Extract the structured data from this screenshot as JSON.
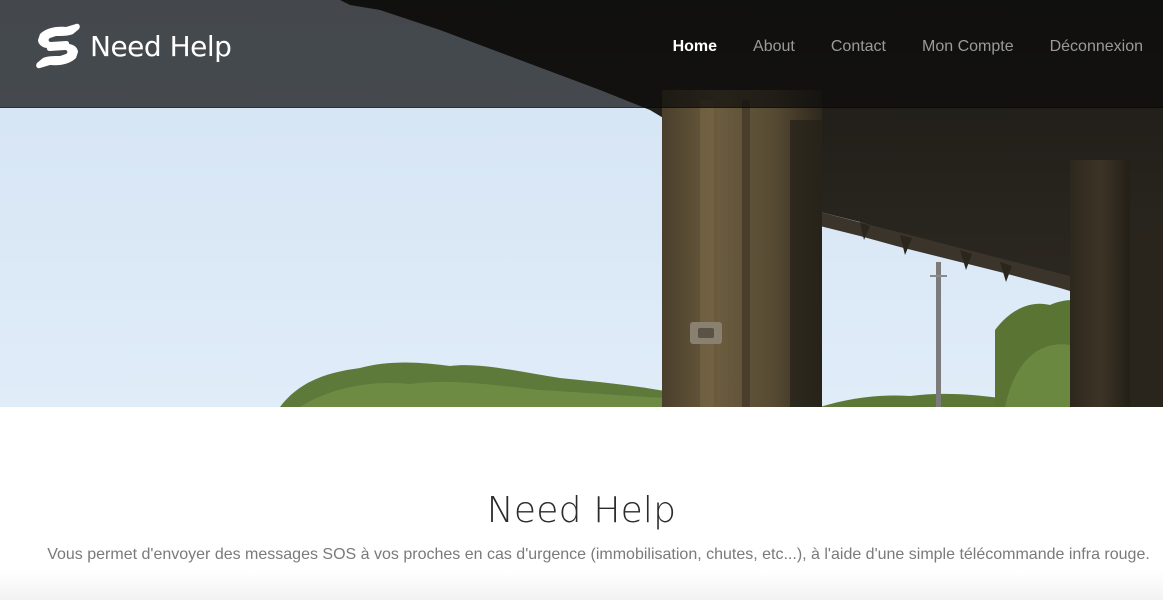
{
  "brand": {
    "name": "Need Help",
    "logo_icon": "helping-hands-icon"
  },
  "nav": {
    "items": [
      {
        "label": "Home",
        "active": true
      },
      {
        "label": "About",
        "active": false
      },
      {
        "label": "Contact",
        "active": false
      },
      {
        "label": "Mon Compte",
        "active": false
      },
      {
        "label": "Déconnexion",
        "active": false
      }
    ]
  },
  "hero": {
    "image": "wooden-porch-beams-over-trees-photo"
  },
  "main": {
    "title": "Need Help",
    "description": "Vous permet d'envoyer des messages SOS à vos proches en cas d'urgence (immobilisation, chutes, etc...), à l'aide d'une simple télécommande infra rouge."
  },
  "colors": {
    "navbar_bg": "#0c0c0c",
    "nav_active": "#ffffff",
    "nav_inactive": "#9a9a9a",
    "title": "#2b2b2b",
    "description": "#7a7a7a",
    "sky": "#dbe8f5"
  }
}
